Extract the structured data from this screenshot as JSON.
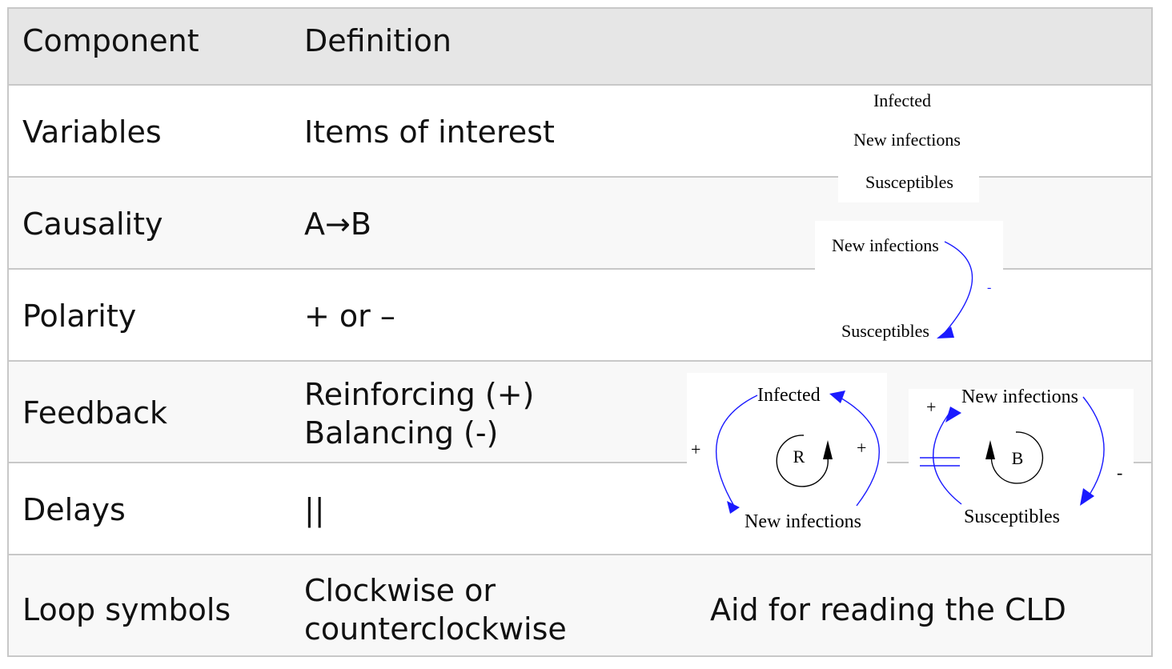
{
  "table": {
    "header": {
      "component": "Component",
      "definition": "Definition"
    },
    "rows": [
      {
        "component": "Variables",
        "definition": "Items of interest"
      },
      {
        "component": "Causality",
        "definition": "A→B"
      },
      {
        "component": "Polarity",
        "definition": "+ or –"
      },
      {
        "component": "Feedback",
        "definition_line1": "Reinforcing (+)",
        "definition_line2": "Balancing (-)"
      },
      {
        "component": "Delays",
        "definition": "||"
      },
      {
        "component": "Loop symbols",
        "definition_line1": "Clockwise or",
        "definition_line2": "counterclockwise"
      }
    ],
    "aid_text": "Aid for reading the CLD"
  },
  "figures": {
    "variables_list": [
      "Infected",
      "New infections",
      "Susceptibles"
    ],
    "causality": {
      "from": "New infections",
      "to": "Susceptibles",
      "polarity": "-"
    },
    "reinforcing_loop": {
      "top": "Infected",
      "bottom": "New infections",
      "left_sign": "+",
      "right_sign": "+",
      "symbol": "R"
    },
    "balancing_loop": {
      "top": "New infections",
      "bottom": "Susceptibles",
      "left_sign": "+",
      "right_sign": "-",
      "symbol": "B"
    }
  },
  "colors": {
    "header_bg": "#e6e6e6",
    "border": "#c8c8c8",
    "arrow": "#1a1aff"
  }
}
